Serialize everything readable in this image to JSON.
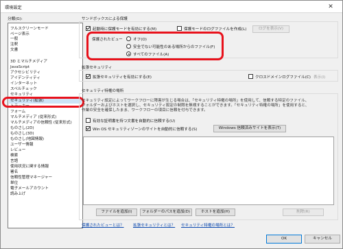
{
  "window": {
    "title": "環境設定",
    "close_glyph": "✕"
  },
  "categories": {
    "label": "分類(G):",
    "items": [
      "フルスクリーンモード",
      "ページ表示",
      "一般",
      "注釈",
      "文書",
      "3D とマルチメディア",
      "JavaScript",
      "アクセシビリティ",
      "アイデンティティ",
      "インターネット",
      "スペルチェック",
      "セキュリティ",
      "セキュリティ(拡張)",
      "トラッカー",
      "フォーム",
      "マルチメディア (従来形式)",
      "マルチメディアの信頼性 (従来形式)",
      "ものさし(2D)",
      "ものさし(3D)",
      "ものさし(地図情報)",
      "ユーザー情報",
      "レビュー",
      "検索",
      "言語",
      "使用状況に関する情報",
      "署名",
      "信頼性管理マネージャー",
      "単位",
      "電子メールアカウント",
      "読み上げ"
    ],
    "selected": "セキュリティ(拡張)"
  },
  "sandbox": {
    "title": "サンドボックスによる保護",
    "enable_protected_mode": "起動時に保護モードを有効にする(M)",
    "create_log": "保護モードのログファイルを作成(L)",
    "view_log_button": "ログを表示(V)"
  },
  "protected_view": {
    "title": "保護されたビュー",
    "options": [
      "オフ(O)",
      "安全でない可能性のある場所からのファイル(F)",
      "すべてのファイル(A)"
    ],
    "selected": "すべてのファイル(A)"
  },
  "enhanced_security": {
    "title": "拡張セキュリティ",
    "enable": "拡張セキュリティを有効にする(E)",
    "cross_domain": "クロスドメインログファイル(C)",
    "view_link": "表示(I)"
  },
  "privileged": {
    "title": "セキュリティ特権の場所",
    "description": "セキュリティ設定によってワークフローに障害が生じる場合は、「セキュリティ特権の場所」を使用して、信頼する特定のファイル、フォルダーおよびホストを選択し、セキュリティ設定の制限を無視することができます。「セキュリティ特権の場所」を使用すると、作業の安全を確保したまま、ワークフローの項目に信頼を付与できます。",
    "auto_trust_certified": "有効な証明書を持つ文書を自動的に信頼する(U)",
    "auto_trust_win_os": "Win OS セキュリティゾーンのサイトを自動的に信頼する(S)",
    "windows_trusted_sites_button": "Windows 信頼済みサイトを表示(T)",
    "add_file_button": "ファイルを追加(I)",
    "add_folder_button": "フォルダーのパスを追加(D)",
    "add_host_button": "ホストを追加(H)",
    "remove_button": "削除(R)"
  },
  "footer_links": {
    "protected_view_link": "保護されたビューとは？",
    "enhanced_security_link": "拡張セキュリティとは？",
    "privileged_locations_link": "セキュリティ特権の場所とは？"
  },
  "buttons": {
    "ok": "OK",
    "cancel": "キャンセル"
  },
  "colors": {
    "highlight_oval": "#e8111b",
    "selected_bg": "#cce4f7",
    "link": "#0645ad"
  }
}
